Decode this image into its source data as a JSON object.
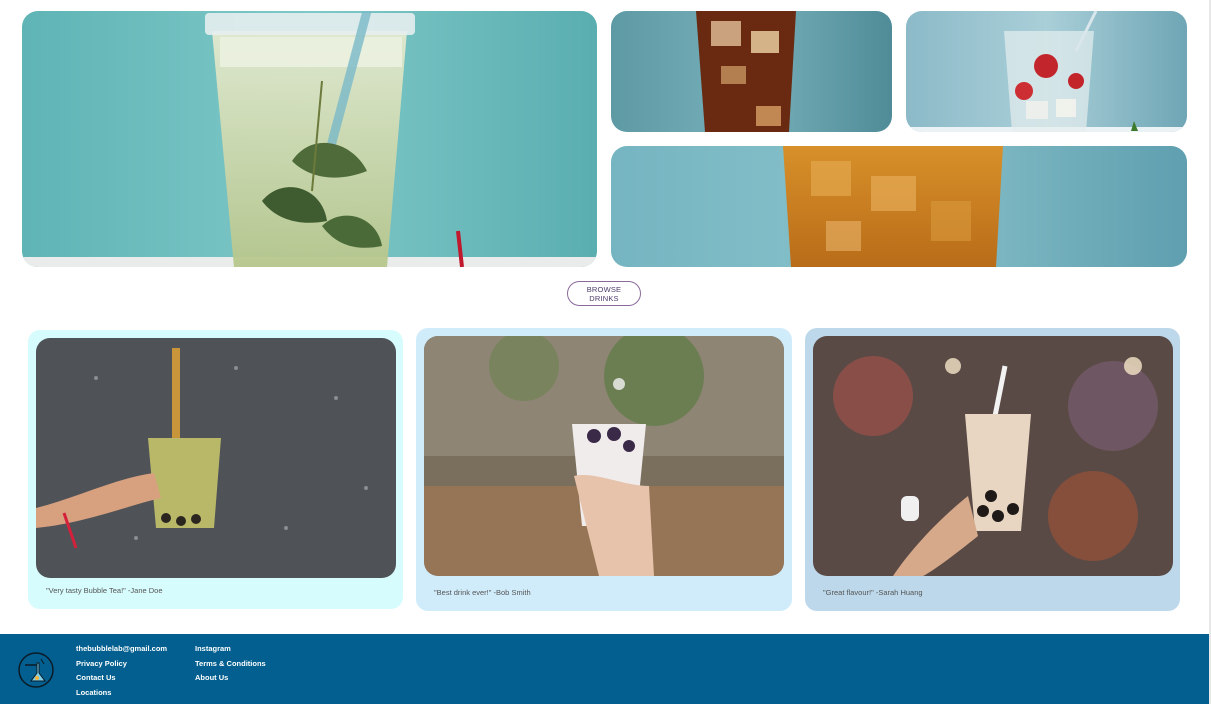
{
  "gallery": {
    "browse_label": "BROWSE DRINKS"
  },
  "testimonials": [
    {
      "quote": "\"Very tasty Bubble Tea!\" -Jane Doe"
    },
    {
      "quote": "\"Best drink ever!\" -Bob Smith"
    },
    {
      "quote": "\"Great flavour!\" -Sarah Huang"
    }
  ],
  "footer": {
    "col1": [
      "thebubblelab@gmail.com",
      "Privacy Policy",
      "Contact Us",
      "Locations"
    ],
    "col2": [
      "Instagram",
      "Terms & Conditions",
      "About Us"
    ]
  },
  "colors": {
    "footer_bg": "#025f8f",
    "card_1_bg": "#d7fcfd",
    "card_2_bg": "#d0ecfb",
    "card_3_bg": "#bdd8ea",
    "teal_backdrop": "#6fbfc2"
  }
}
